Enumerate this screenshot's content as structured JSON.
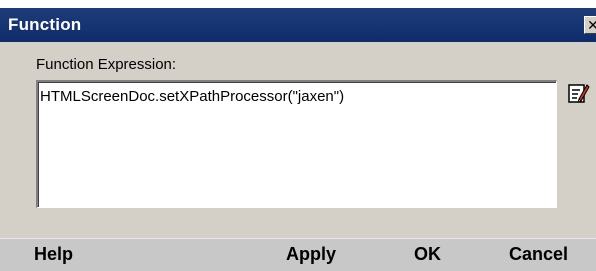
{
  "window": {
    "title": "Function",
    "close_glyph": "✕",
    "close_icon": "close-icon"
  },
  "form": {
    "expression_label": "Function Expression:",
    "expression_value": "HTMLScreenDoc.setXPathProcessor(\"jaxen\")",
    "edit_icon": "edit-icon"
  },
  "buttons": {
    "help": "Help",
    "apply": "Apply",
    "ok": "OK",
    "cancel": "Cancel"
  },
  "colors": {
    "titlebar": "#0e2c6b",
    "dialog_background": "#d4d0c8",
    "button_bar": "#c8c8c8"
  }
}
